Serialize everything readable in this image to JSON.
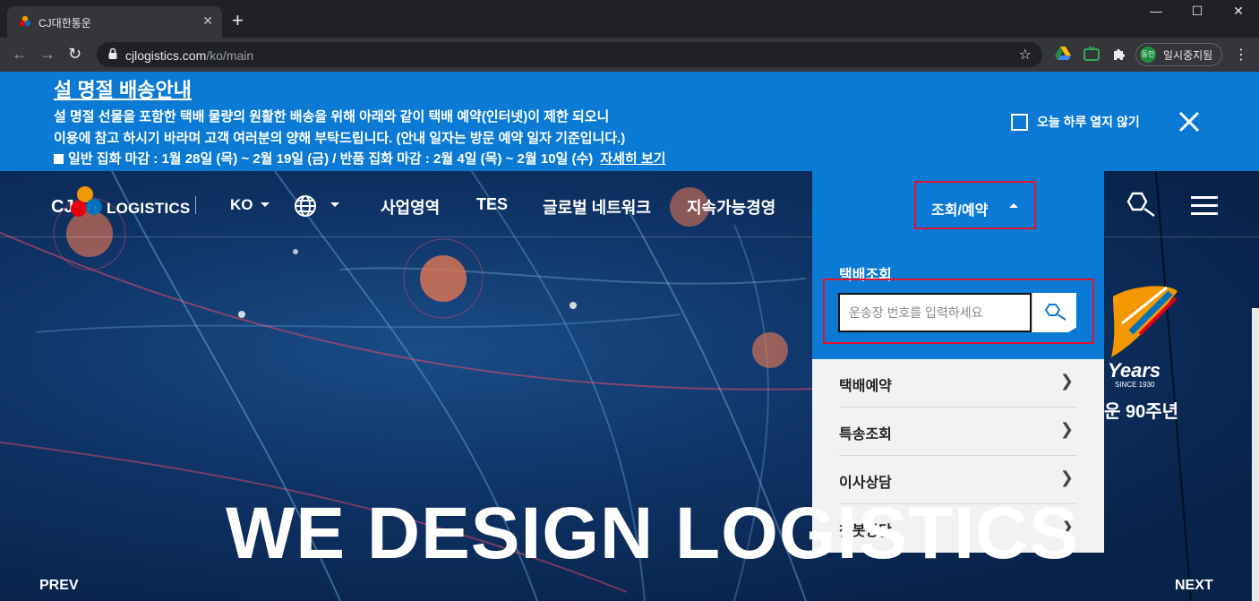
{
  "browser": {
    "tab_title": "CJ대한통운",
    "tab_close": "✕",
    "new_tab": "+",
    "url_host": "cjlogistics.com",
    "url_path": "/ko/main",
    "profile_avatar": "동민",
    "profile_label": "일시중지됨",
    "window_controls": {
      "minimize": "—",
      "maximize": "☐",
      "close": "✕"
    }
  },
  "notice": {
    "title": "설 명절 배송안내",
    "line1": "설 명절 선물을 포함한 택배 물량의 원활한 배송을 위해 아래와 같이 택배 예약(인터넷)이 제한 되오니",
    "line2": "이용에 참고 하시기 바라며 고객 여러분의 양해 부탁드립니다. (안내 일자는 방문 예약 일자 기준입니다.)",
    "line3": "일반 집화 마감 : 1월 28일 (목) ~ 2월 19일 (금)  /  반품 집화 마감 : 2월 4일 (목) ~ 2월 10일 (수)",
    "detail_link": "자세히 보기",
    "dont_show_today": "오늘 하루 열지 않기"
  },
  "header": {
    "logo_cj": "CJ",
    "logo_text": "LOGISTICS",
    "language": "KO",
    "menu": [
      "사업영역",
      "TES",
      "글로벌 네트워크",
      "지속가능경영"
    ],
    "lookup_menu": "조회/예약"
  },
  "dropdown": {
    "tracking_title": "택배조회",
    "tracking_placeholder": "운송장 번호를 입력하세요",
    "items": [
      "택배예약",
      "특송조회",
      "이사상담",
      "챗봇상담"
    ]
  },
  "anniversary": {
    "years": "Years",
    "since": "SINCE 1930",
    "caption": "운 90주년"
  },
  "hero": {
    "headline": "WE DESIGN LOGISTICS",
    "prev": "PREV",
    "next": "NEXT"
  },
  "colors": {
    "brand_blue": "#0a7ad4",
    "highlight_red": "#e0132c",
    "cj_orange": "#f39800",
    "cj_red": "#e60012",
    "cj_blue": "#0072bc"
  }
}
